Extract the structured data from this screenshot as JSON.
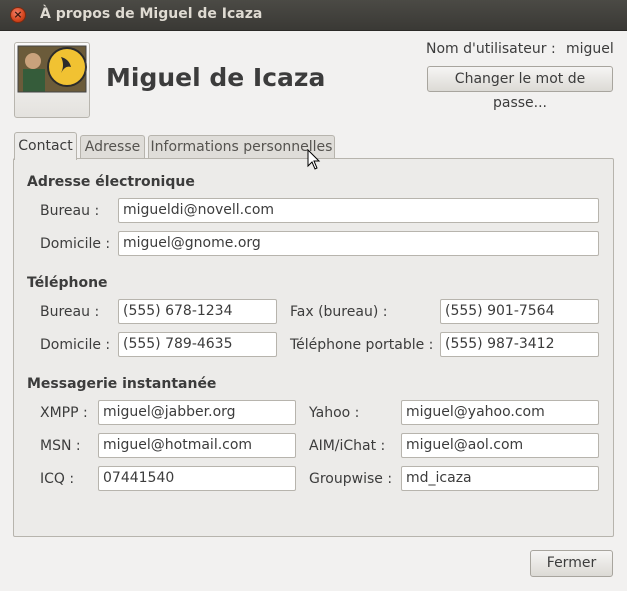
{
  "window": {
    "title": "À propos de Miguel de Icaza",
    "close_glyph": "×"
  },
  "header": {
    "name": "Miguel de Icaza",
    "username_label": "Nom d'utilisateur :",
    "username_value": "miguel",
    "change_password_label": "Changer le mot de passe..."
  },
  "tabs": [
    {
      "label": "Contact",
      "active": true
    },
    {
      "label": "Adresse",
      "active": false
    },
    {
      "label": "Informations personnelles",
      "active": false
    }
  ],
  "email": {
    "heading": "Adresse électronique",
    "work_label": "Bureau :",
    "work_value": "migueldi@novell.com",
    "home_label": "Domicile :",
    "home_value": "miguel@gnome.org"
  },
  "phone": {
    "heading": "Téléphone",
    "work_label": "Bureau :",
    "work_value": "(555) 678-1234",
    "fax_label": "Fax (bureau) :",
    "fax_value": "(555) 901-7564",
    "home_label": "Domicile :",
    "home_value": "(555) 789-4635",
    "mobile_label": "Téléphone portable :",
    "mobile_value": "(555) 987-3412"
  },
  "im": {
    "heading": "Messagerie instantanée",
    "xmpp_label": "XMPP :",
    "xmpp_value": "miguel@jabber.org",
    "yahoo_label": "Yahoo :",
    "yahoo_value": "miguel@yahoo.com",
    "msn_label": "MSN :",
    "msn_value": "miguel@hotmail.com",
    "aim_label": "AIM/iChat :",
    "aim_value": "miguel@aol.com",
    "icq_label": "ICQ :",
    "icq_value": "07441540",
    "groupwise_label": "Groupwise :",
    "groupwise_value": "md_icaza"
  },
  "footer": {
    "close_label": "Fermer"
  },
  "colors": {
    "titlebar": "#3c3b37",
    "close_button": "#df4a16",
    "window_bg": "#f2f1f0"
  }
}
